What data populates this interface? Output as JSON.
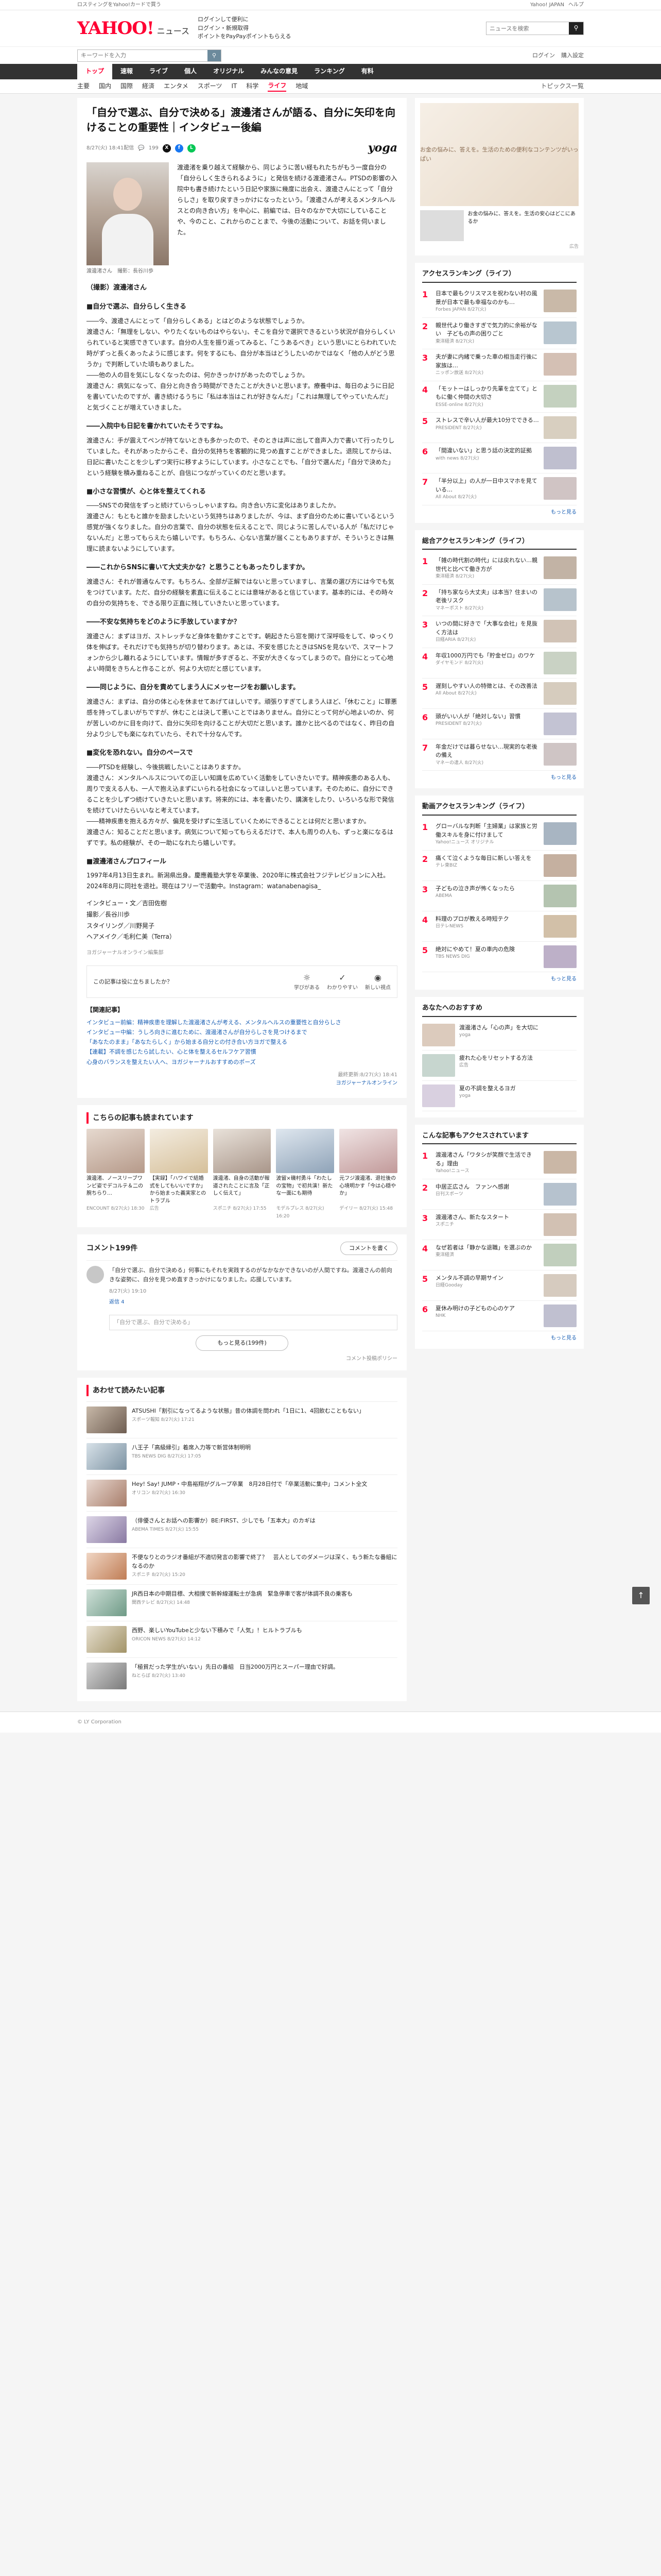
{
  "topstrip": {
    "promo": "ロスティングをYahoo!カードで買う",
    "login": "Yahoo! JAPAN",
    "help": "ヘルプ"
  },
  "header": {
    "logo_main": "YAHOO!",
    "logo_sub": "ニュース",
    "links": [
      "ログインして便利に",
      "ログイン・新規取得",
      "ポイントをPayPayポイントもらえる"
    ],
    "search_placeholder": "ニュースを検索",
    "search_btn": "検索"
  },
  "searchbar": {
    "placeholder": "キーワードを入力",
    "right": [
      "ログイン",
      "購入設定"
    ]
  },
  "nav": [
    "トップ",
    "速報",
    "ライブ",
    "個人",
    "オリジナル",
    "みんなの意見",
    "ランキング",
    "有料"
  ],
  "subnav": {
    "items": [
      "主要",
      "国内",
      "国際",
      "経済",
      "エンタメ",
      "スポーツ",
      "IT",
      "科学",
      "ライフ",
      "地域"
    ],
    "active": "ライフ",
    "right": "トピックス一覧"
  },
  "article": {
    "title": "「自分で選ぶ、自分で決める」渡邊渚さんが語る、自分に矢印を向けることの重要性｜インタビュー後編",
    "date": "8/27(火) 18:41配信",
    "comments_count": "199",
    "provider": "yoga",
    "caption": "渡邊渚さん　撮影：長谷川歩",
    "lead": "渡邊渚を乗り越えて経験から、同じように苦い経もれたちがもう一度自分の「自分らしく生きられるように」と発信を続ける渡邊渚さん。PTSDの影響の入院中も書き続けたという日記や家族に幾度に出会え、渡邊さんにとって「自分らしさ」を取り戻すきっかけになったという。「渡邊さんが考えるメンタルヘルスとの向き合い方」を中心に、前編では、日々のなかで大切にしていることや、今のこと、これからのことまで、今後の活動について、お話を伺いました。",
    "section_label": "（撮影）渡邊渚さん",
    "sections": [
      {
        "heading": "■自分で選ぶ、自分らしく生きる",
        "body": "――今、渡邊さんにとって「自分らしくある」とはどのような状態でしょうか。\n渡邊さん：「無理をしない、やりたくないものはやらない」、そこを自分で選択できるという状況が自分らしくいられていると実感できています。自分の人生を振り返ってみると、「こうあるべき」という思いにとらわれていた時がずっと長くあったように感じます。何をするにも、自分が本当はどうしたいのかではなく「他の人がどう思うか」で判断していた頃もありました。\n――他の人の目を気にしなくなったのは、何かきっかけがあったのでしょうか。\n渡邊さん：病気になって、自分と向き合う時間ができたことが大きいと思います。療養中は、毎日のように日記を書いていたのですが、書き続けるうちに「私は本当はこれが好きなんだ」「これは無理してやっていたんだ」と気づくことが増えていきました。"
      },
      {
        "heading": "――入院中も日記を書かれていたそうですね。",
        "body": "渡邊さん：手が震えてペンが持てないときも多かったので、そのときは声に出して音声入力で書いて行ったりしていました。それがあったからこそ、自分の気持ちを客観的に見つめ直すことができました。退院してからは、日記に書いたことを少しずつ実行に移すようにしています。小さなことでも、「自分で選んだ」「自分で決めた」という経験を積み重ねることが、自信につながっていくのだと思います。"
      },
      {
        "heading": "■小さな習慣が、心と体を整えてくれる",
        "body": "――SNSでの発信をずっと続けていらっしゃいますね。向き合い方に変化はありましたか。\n渡邊さん：もともと誰かを励ましたいという気持ちはありましたが、今は、まず自分のために書いているという感覚が強くなりました。自分の言葉で、自分の状態を伝えることで、同じように苦しんでいる人が「私だけじゃないんだ」と思ってもらえたら嬉しいです。もちろん、心ない言葉が届くこともありますが、そういうときは無理に読まないようにしています。"
      },
      {
        "heading": "――これからSNSに書いて大丈夫かな？と思うこともあったりしますか。",
        "body": "渡邊さん：それが普通なんです。もちろん、全部が正解ではないと思っていますし、言葉の選び方には今でも気をつけています。ただ、自分の経験を素直に伝えることには意味があると信じています。基本的には、その時々の自分の気持ちを、できる限り正直に残していきたいと思っています。"
      },
      {
        "heading": "――不安な気持ちをどのように手放していますか？",
        "body": "渡邊さん：まずはヨガ、ストレッチなど身体を動かすことです。朝起きたら窓を開けて深呼吸をして、ゆっくり体を伸ばす。それだけでも気持ちが切り替わります。あとは、不安を感じたときはSNSを見ないで、スマートフォンから少し離れるようにしています。情報が多すぎると、不安が大きくなってしまうので。自分にとって心地よい時間をきちんと作ることが、何より大切だと感じています。"
      },
      {
        "heading": "――同じように、自分を責めてしまう人にメッセージをお願いします。",
        "body": "渡邊さん：まずは、自分の体と心を休ませてあげてほしいです。頑張りすぎてしまう人ほど、「休むこと」に罪悪感を持ってしまいがちですが、休むことは決して悪いことではありません。自分にとって何が心地よいのか、何が苦しいのかに目を向けて、自分に矢印を向けることが大切だと思います。誰かと比べるのではなく、昨日の自分より少しでも楽になれていたら、それで十分なんです。"
      },
      {
        "heading": "■変化を恐れない。自分のペースで",
        "body": "――PTSDを経験し、今後挑戦したいことはありますか。\n渡邊さん：メンタルヘルスについての正しい知識を広めていく活動をしていきたいです。精神疾患のある人も、周りで支える人も、一人で抱え込まずにいられる社会になってほしいと思っています。そのために、自分にできることを少しずつ続けていきたいと思います。将来的には、本を書いたり、講演をしたり、いろいろな形で発信を続けていけたらいいなと考えています。\n――精神疾患を抱える方々が、偏見を受けずに生活していくためにできることとは何だと思いますか。\n渡邊さん：知ることだと思います。病気について知ってもらえるだけで、本人も周りの人も、ずっと楽になるはずです。私の経験が、その一助になれたら嬉しいです。"
      }
    ],
    "profile_heading": "■渡邊渚さんプロフィール",
    "profile": "1997年4月13日生まれ。新潟県出身。慶應義塾大学を卒業後、2020年に株式会社フジテレビジョンに入社。2024年8月に同社を退社。現在はフリーで活動中。Instagram：watanabenagisa_",
    "credits": "インタビュー・文／吉田佐樹\n撮影／長谷川歩\nスタイリング／川野晃子\nヘアメイク／毛利仁美（Terra）",
    "source": "ヨガジャーナルオンライン編集部",
    "feedback": {
      "question": "この記事は役に立ちましたか？",
      "options": [
        "学びがある",
        "わかりやすい",
        "新しい視点"
      ]
    },
    "related_heading": "【関連記事】",
    "related": [
      "インタビュー前編：精神疾患を理解した渡邊渚さんが考える、メンタルヘルスの重要性と自分らしさ",
      "インタビュー中編：うしろ向きに進むために、渡邊渚さんが自分らしさを見つけるまで",
      "「あなたのまま」「あなたらしく」から始まる自分との付き合い方ヨガで整える",
      "【連載】不調を感じたら試したい、心と体を整えるセルフケア習慣",
      "心身のバランスを整えたい人へ、ヨガジャーナルおすすめのポーズ"
    ],
    "updated": "最終更新:8/27(火) 18:41",
    "tail": "ヨガジャーナルオンライン"
  },
  "recommend": {
    "title": "こちらの記事も読まれています",
    "items": [
      {
        "t": "渡邊渚、ノースリーブワンピ姿でデコルテ＆二の腕ちらり…",
        "s": "ENCOUNT 8/27(火) 18:30"
      },
      {
        "t": "【実録】「ハワイで結婚式をしてもいいですか」から始まった義実家とのトラブル",
        "s": "広告"
      },
      {
        "t": "渡邊渚、自身の活動が報道されたことに言及「正しく伝えて」",
        "s": "スポニチ 8/27(火) 17:55"
      },
      {
        "t": "波留×磯村勇斗「わたしの宝物」で初共演！新たな一面にも期待",
        "s": "モデルプレス 8/27(火) 16:20"
      },
      {
        "t": "元フジ渡邊渚、退社後の心境明かす「今は心穏やか」",
        "s": "デイリー 8/27(火) 15:48"
      }
    ]
  },
  "comments": {
    "title": "コメント199件",
    "post_btn": "コメントを書く",
    "items": [
      {
        "text": "「自分で選ぶ、自分で決める」何事にもそれを実践するのがなかなかできないのが人間ですね。渡邊さんの前向きな姿勢に、自分を見つめ直すきっかけになりました。応援しています。",
        "info": "8/27(火) 19:10",
        "reply": "返信 4"
      }
    ],
    "input_placeholder": "「自分で選ぶ、自分で決める」",
    "more": "もっと見る(199件)",
    "policy": "コメント投稿ポリシー"
  },
  "more_list": {
    "title": "あわせて読みたい記事",
    "items": [
      {
        "t": "ATSUSHI「割引になってるような状態」昔の体調を問われ「1日に1、4回飲むこともない」",
        "s": "スポーツ報知 8/27(火) 17:21"
      },
      {
        "t": "八王子「高級縁引」着席入力等で新営体制明明",
        "s": "TBS NEWS DIG 8/27(火) 17:05"
      },
      {
        "t": "Hey! Say! JUMP・中島裕翔がグループ卒業　8月28日付で「卒業活動に集中」コメント全文",
        "s": "オリコン 8/27(火) 16:30"
      },
      {
        "t": "（俳優さんとお話への影響か）BE:FIRST、少しでも「五本大」のカギは",
        "s": "ABEMA TIMES 8/27(火) 15:55"
      },
      {
        "t": "不便なりとのラジオ番組が不適切発言の影響で終了？　芸人としてのダメージは深く、もう新たな番組になるのか",
        "s": "スポニチ 8/27(火) 15:20"
      },
      {
        "t": "JR西日本の中期目標、大相撲で新幹線運転士が急病　緊急停車で客が体調不良の乗客も",
        "s": "関西テレビ 8/27(火) 14:48"
      },
      {
        "t": "西野、楽しいYouTubeと少ない下積みで「人気」！ヒルトラブルも",
        "s": "ORICON NEWS 8/27(火) 14:12"
      },
      {
        "t": "「極貧だった学生がいない」先日の番組　日当2000万円とスーパー理由で好調。",
        "s": "ねとらぼ 8/27(火) 13:40"
      }
    ]
  },
  "sidebar": {
    "ad_caption": "お金の悩みに、答えを。生活のための便利なコンテンツがいっぱい",
    "ad_row": "お金の悩みに、答えを。生活の安心はどこにあるか",
    "ad_label": "広告",
    "rank1_title": "アクセスランキング（ライフ）",
    "rank1": [
      {
        "t": "日本で最もクリスマスを祝わない村の風景が日本で最も幸福なのかも…",
        "s": "Forbes JAPAN 8/27(火)"
      },
      {
        "t": "親世代より働きすぎで気力的に余裕がない　子どもの声の困りごと",
        "s": "東洋経済 8/27(火)"
      },
      {
        "t": "夫が妻に内緒で乗った車の相当走行後に家族は…",
        "s": "ニッポン放送 8/27(火)"
      },
      {
        "t": "「モットーはしっかり先輩を立てて」ともに働く仲間の大切さ",
        "s": "ESSE-online 8/27(火)"
      },
      {
        "t": "ストレスで辛い人が最大10分でできる…",
        "s": "PRESIDENT 8/27(火)"
      },
      {
        "t": "「間違いない」と思う話の決定的証拠",
        "s": "with news 8/27(火)"
      },
      {
        "t": "「半分以上」の人が一日中スマホを見ている…",
        "s": "All About 8/27(火)"
      }
    ],
    "rank2_title": "総合アクセスランキング（ライフ）",
    "rank2": [
      {
        "t": "「雑の時代割の時代」には戻れない…親世代と比べて働き方が",
        "s": "東洋経済 8/27(火)"
      },
      {
        "t": "「持ち家なら大丈夫」は本当？住まいの老後リスク",
        "s": "マネーポスト 8/27(火)"
      },
      {
        "t": "いつの間に好きで「大事な会社」を見抜く方法は",
        "s": "日経ARIA 8/27(火)"
      },
      {
        "t": "年収1000万円でも「貯金ゼロ」のワケ",
        "s": "ダイヤモンド 8/27(火)"
      },
      {
        "t": "遅刻しやすい人の特徴とは、その改善法",
        "s": "All About 8/27(火)"
      },
      {
        "t": "頭がいい人が「絶対しない」習慣",
        "s": "PRESIDENT 8/27(火)"
      },
      {
        "t": "年金だけでは暮らせない…現実的な老後の備え",
        "s": "マネーの達人 8/27(火)"
      }
    ],
    "rank3_title": "動画アクセスランキング（ライフ）",
    "rank3": [
      {
        "t": "グローバルな判断「主婦業」は家族と労働スキルを身に付けまして",
        "s": "Yahoo!ニュース オリジナル"
      },
      {
        "t": "痛くて泣くような毎日に新しい答えを",
        "s": "テレ東BIZ"
      },
      {
        "t": "子どもの泣き声が怖くなったら",
        "s": "ABEMA"
      },
      {
        "t": "料理のプロが教える時短テク",
        "s": "日テレNEWS"
      },
      {
        "t": "絶対にやめて！夏の車内の危険",
        "s": "TBS NEWS DIG"
      }
    ],
    "recommend_title": "あなたへのおすすめ",
    "recommend_side": [
      {
        "t": "渡邊渚さん「心の声」を大切に",
        "s": "yoga"
      },
      {
        "t": "疲れた心をリセットする方法",
        "s": "広告"
      },
      {
        "t": "夏の不調を整えるヨガ",
        "s": "yoga"
      }
    ],
    "rank4_title": "こんな記事もアクセスされています",
    "rank4": [
      {
        "t": "渡邊渚さん「ワタシが笑顔で生活できる」理由",
        "s": "Yahoo!ニュース"
      },
      {
        "t": "中居正広さん　ファンへ感謝",
        "s": "日刊スポーツ"
      },
      {
        "t": "渡邊渚さん、新たなスタート",
        "s": "スポニチ"
      },
      {
        "t": "なぜ若者は「静かな退職」を選ぶのか",
        "s": "東洋経済"
      },
      {
        "t": "メンタル不調の早期サイン",
        "s": "日経Gooday"
      },
      {
        "t": "夏休み明けの子どもの心のケア",
        "s": "NHK"
      }
    ],
    "more": "もっと見る"
  },
  "footer": "© LY Corporation"
}
